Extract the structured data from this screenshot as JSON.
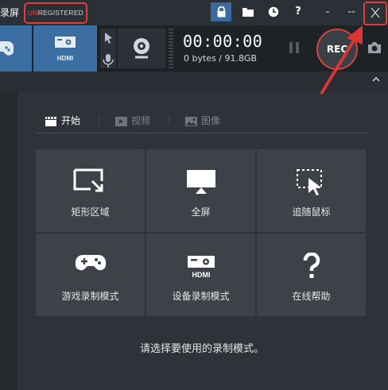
{
  "window": {
    "title": "录屏",
    "registration_prefix": "UN",
    "registration_suffix": "REGISTERED"
  },
  "toolbar": {
    "hdmi_label": "HDMI",
    "timer": "00:00:00",
    "size": "0 bytes / 91.8GB",
    "rec_label": "REC"
  },
  "tabs": [
    {
      "label": "开始",
      "icon": "clapperboard-icon",
      "active": true
    },
    {
      "label": "视频",
      "icon": "video-icon",
      "active": false
    },
    {
      "label": "图像",
      "icon": "image-icon",
      "active": false
    }
  ],
  "modes": [
    {
      "label": "矩形区域",
      "icon": "rectangle-area-icon"
    },
    {
      "label": "全屏",
      "icon": "fullscreen-monitor-icon"
    },
    {
      "label": "追随鼠标",
      "icon": "follow-mouse-icon"
    },
    {
      "label": "游戏录制模式",
      "icon": "gamepad-icon"
    },
    {
      "label": "设备录制模式",
      "icon": "hdmi-device-icon"
    },
    {
      "label": "在线帮助",
      "icon": "question-icon"
    }
  ],
  "hint": "请选择要使用的录制模式。",
  "colors": {
    "accent": "#3b6fa4",
    "highlight": "#e23b3b",
    "tile": "#3d4249"
  }
}
